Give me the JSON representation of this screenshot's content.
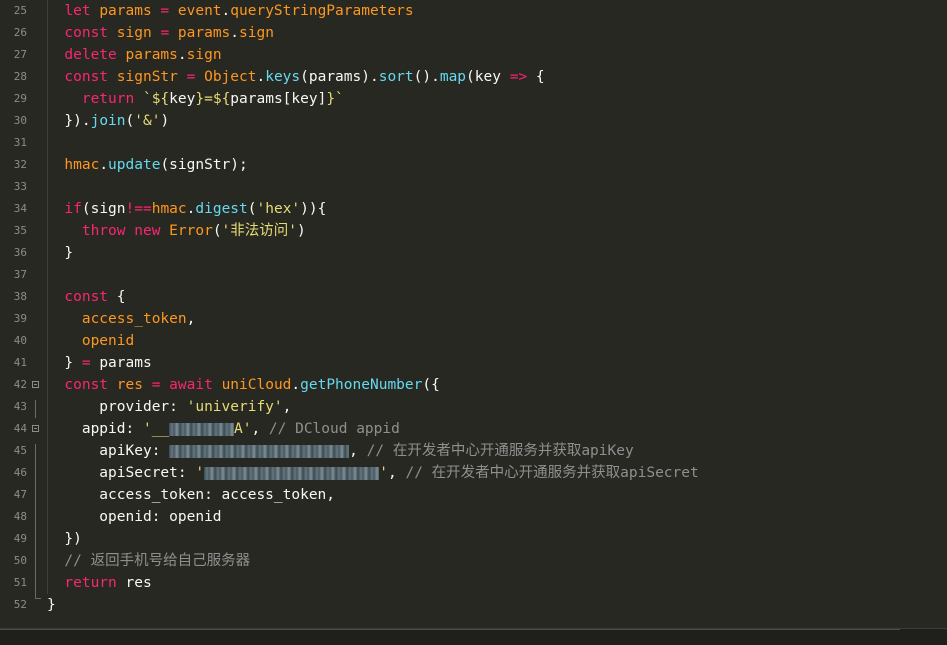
{
  "editor": {
    "line_numbers": [
      "25",
      "26",
      "27",
      "28",
      "29",
      "30",
      "31",
      "32",
      "33",
      "34",
      "35",
      "36",
      "37",
      "38",
      "39",
      "40",
      "41",
      "42",
      "43",
      "44",
      "45",
      "46",
      "47",
      "48",
      "49",
      "50",
      "51",
      "52"
    ],
    "lines": [
      [
        {
          "t": "let ",
          "c": "kw"
        },
        {
          "t": "params ",
          "c": "var"
        },
        {
          "t": "= ",
          "c": "op"
        },
        {
          "t": "event",
          "c": "var"
        },
        {
          "t": ".",
          "c": "plain"
        },
        {
          "t": "queryStringParameters",
          "c": "var"
        }
      ],
      [
        {
          "t": "const ",
          "c": "kw"
        },
        {
          "t": "sign ",
          "c": "var"
        },
        {
          "t": "= ",
          "c": "op"
        },
        {
          "t": "params",
          "c": "var"
        },
        {
          "t": ".",
          "c": "plain"
        },
        {
          "t": "sign",
          "c": "var"
        }
      ],
      [
        {
          "t": "delete ",
          "c": "kw"
        },
        {
          "t": "params",
          "c": "var"
        },
        {
          "t": ".",
          "c": "plain"
        },
        {
          "t": "sign",
          "c": "var"
        }
      ],
      [
        {
          "t": "const ",
          "c": "kw"
        },
        {
          "t": "signStr ",
          "c": "var"
        },
        {
          "t": "= ",
          "c": "op"
        },
        {
          "t": "Object",
          "c": "var"
        },
        {
          "t": ".",
          "c": "plain"
        },
        {
          "t": "keys",
          "c": "fn"
        },
        {
          "t": "(params).",
          "c": "plain"
        },
        {
          "t": "sort",
          "c": "fn"
        },
        {
          "t": "().",
          "c": "plain"
        },
        {
          "t": "map",
          "c": "fn"
        },
        {
          "t": "(key ",
          "c": "plain"
        },
        {
          "t": "=> ",
          "c": "kw"
        },
        {
          "t": "{",
          "c": "plain"
        }
      ],
      [
        {
          "t": "  return ",
          "c": "kw"
        },
        {
          "t": "`${",
          "c": "str"
        },
        {
          "t": "key",
          "c": "plain"
        },
        {
          "t": "}=${",
          "c": "str"
        },
        {
          "t": "params[key]",
          "c": "plain"
        },
        {
          "t": "}`",
          "c": "str"
        }
      ],
      [
        {
          "t": "}).",
          "c": "plain"
        },
        {
          "t": "join",
          "c": "fn"
        },
        {
          "t": "(",
          "c": "plain"
        },
        {
          "t": "'&'",
          "c": "str"
        },
        {
          "t": ")",
          "c": "plain"
        }
      ],
      [],
      [
        {
          "t": "hmac",
          "c": "var"
        },
        {
          "t": ".",
          "c": "plain"
        },
        {
          "t": "update",
          "c": "fn"
        },
        {
          "t": "(signStr);",
          "c": "plain"
        }
      ],
      [],
      [
        {
          "t": "if",
          "c": "kw"
        },
        {
          "t": "(sign",
          "c": "plain"
        },
        {
          "t": "!==",
          "c": "op"
        },
        {
          "t": "hmac",
          "c": "var"
        },
        {
          "t": ".",
          "c": "plain"
        },
        {
          "t": "digest",
          "c": "fn"
        },
        {
          "t": "(",
          "c": "plain"
        },
        {
          "t": "'hex'",
          "c": "str"
        },
        {
          "t": ")){",
          "c": "plain"
        }
      ],
      [
        {
          "t": "  throw ",
          "c": "kw"
        },
        {
          "t": "new ",
          "c": "kw"
        },
        {
          "t": "Error",
          "c": "var"
        },
        {
          "t": "(",
          "c": "plain"
        },
        {
          "t": "'非法访问'",
          "c": "str"
        },
        {
          "t": ")",
          "c": "plain"
        }
      ],
      [
        {
          "t": "}",
          "c": "plain"
        }
      ],
      [],
      [
        {
          "t": "const ",
          "c": "kw"
        },
        {
          "t": "{",
          "c": "plain"
        }
      ],
      [
        {
          "t": "  access_token",
          "c": "var"
        },
        {
          "t": ",",
          "c": "plain"
        }
      ],
      [
        {
          "t": "  openid",
          "c": "var"
        }
      ],
      [
        {
          "t": "} ",
          "c": "plain"
        },
        {
          "t": "= ",
          "c": "op"
        },
        {
          "t": "params",
          "c": "plain"
        }
      ],
      [
        {
          "t": "const ",
          "c": "kw"
        },
        {
          "t": "res ",
          "c": "var"
        },
        {
          "t": "= ",
          "c": "op"
        },
        {
          "t": "await ",
          "c": "kw"
        },
        {
          "t": "uniCloud",
          "c": "var"
        },
        {
          "t": ".",
          "c": "plain"
        },
        {
          "t": "getPhoneNumber",
          "c": "fn"
        },
        {
          "t": "({",
          "c": "plain"
        }
      ],
      [
        {
          "t": "    provider: ",
          "c": "plain"
        },
        {
          "t": "'univerify'",
          "c": "str"
        },
        {
          "t": ",",
          "c": "plain"
        }
      ],
      [
        {
          "t": "  appid: ",
          "c": "plain"
        },
        {
          "t": "'__",
          "c": "str"
        },
        {
          "t": "BLUR:108",
          "c": "blur"
        },
        {
          "t": "A'",
          "c": "str"
        },
        {
          "t": ", ",
          "c": "plain"
        },
        {
          "t": "// DCloud appid",
          "c": "cm"
        }
      ],
      [
        {
          "t": "    apiKey: ",
          "c": "plain"
        },
        {
          "t": "BLUR:300",
          "c": "blur"
        },
        {
          "t": ", ",
          "c": "plain"
        },
        {
          "t": "// 在开发者中心开通服务并获取apiKey",
          "c": "cm"
        }
      ],
      [
        {
          "t": "    apiSecret: ",
          "c": "plain"
        },
        {
          "t": "'",
          "c": "str"
        },
        {
          "t": "BLUR:292",
          "c": "blur"
        },
        {
          "t": "'",
          "c": "str"
        },
        {
          "t": ", ",
          "c": "plain"
        },
        {
          "t": "// 在开发者中心开通服务并获取apiSecret",
          "c": "cm"
        }
      ],
      [
        {
          "t": "    access_token: access_token,",
          "c": "plain"
        }
      ],
      [
        {
          "t": "    openid: openid",
          "c": "plain"
        }
      ],
      [
        {
          "t": "})",
          "c": "plain"
        }
      ],
      [
        {
          "t": "// 返回手机号给自己服务器",
          "c": "cm"
        }
      ],
      [
        {
          "t": "return ",
          "c": "kw"
        },
        {
          "t": "res",
          "c": "plain"
        }
      ],
      [
        {
          "t": "}",
          "c": "plain"
        }
      ]
    ],
    "indent": [
      1,
      1,
      1,
      1,
      1,
      1,
      0,
      1,
      0,
      1,
      1,
      1,
      0,
      1,
      1,
      1,
      1,
      1,
      1,
      1,
      1,
      1,
      1,
      1,
      1,
      1,
      1,
      0
    ]
  },
  "colors": {
    "background": "#272822",
    "keyword": "#f92672",
    "function": "#66d9ef",
    "string": "#e6db74",
    "variable": "#fd971f",
    "comment": "#8f8f8f"
  }
}
